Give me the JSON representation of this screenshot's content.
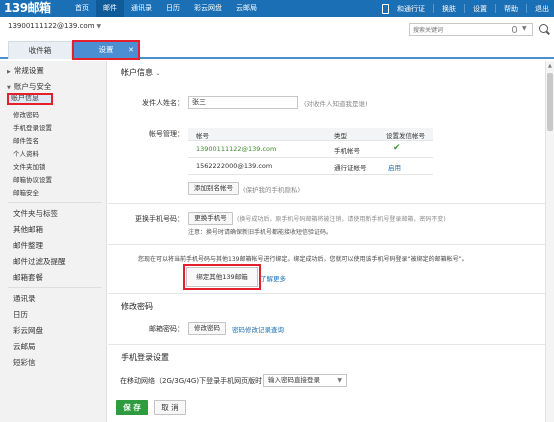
{
  "header": {
    "logo": "139邮箱",
    "nav": [
      "首页",
      "邮件",
      "通讯录",
      "日历",
      "彩云网盘",
      "云邮局"
    ],
    "right": [
      "和通行证",
      "换肤",
      "设置",
      "帮助",
      "退出"
    ]
  },
  "account": {
    "email": "13900111122@139.com"
  },
  "search": {
    "placeholder": "搜索关键词"
  },
  "tabs": {
    "inbox": "收件箱",
    "settings": "设置"
  },
  "sidebar": {
    "general": "常规设置",
    "account_security": "账户与安全",
    "items": [
      "账户信息",
      "修改密码",
      "手机登录设置",
      "邮件签名",
      "个人资料",
      "文件夹加锁",
      "邮箱协议设置",
      "邮箱安全"
    ],
    "sections": [
      "文件夹与标签",
      "其他邮箱",
      "邮件整理",
      "邮件过滤及提醒",
      "邮箱套餐"
    ],
    "others": [
      "通讯录",
      "日历",
      "彩云网盘",
      "云邮局",
      "短彩信"
    ]
  },
  "account_info": {
    "title": "帐户信息",
    "sender_label": "发件人姓名：",
    "sender_value": "张三",
    "sender_hint": "(对收件人知道我是谁)",
    "manage_label": "帐号管理：",
    "table_headers": [
      "帐号",
      "类型",
      "设置发信帐号"
    ],
    "rows": [
      {
        "account": "13900111122@139.com",
        "type": "手机帐号",
        "action": "✔"
      },
      {
        "account": "1562222000@139.com",
        "type": "通行证帐号",
        "action": "启用"
      }
    ],
    "add_alias_btn": "添加别名帐号",
    "alias_hint": "(保护我的手机隐私)",
    "change_phone_label": "更换手机号码：",
    "change_phone_btn": "更换手机号",
    "change_phone_hint": "(换号成功后，原手机号码邮箱将被注销，请使用新手机号登录邮箱，密码不变)",
    "note": "注意：换号时请确保新旧手机号都能接收短信验证码。",
    "bind_desc": "您现在可以将当前手机号码与其他139邮箱帐号进行绑定。绑定成功后，您就可以使用该手机号码登录“被绑定的邮箱帐号”。",
    "bind_btn": "绑定其他139邮箱",
    "learn_more": "了解更多"
  },
  "password": {
    "title": "修改密码",
    "label": "邮箱密码：",
    "button": "修改密码",
    "history_link": "密码修改记录查询"
  },
  "mobile_login": {
    "title": "手机登录设置",
    "label": "在移动网络（2G/3G/4G)下登录手机网页版时：",
    "option": "输入密码直接登录"
  },
  "footer": {
    "save": "保 存",
    "cancel": "取 消"
  }
}
